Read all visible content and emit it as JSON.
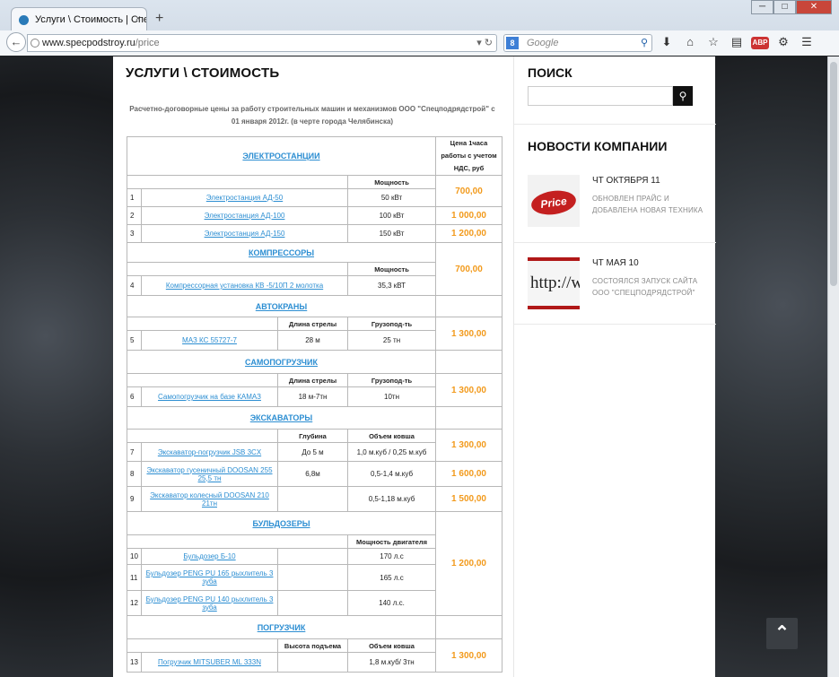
{
  "browser": {
    "tab_title": "Услуги \\ Стоимость | Спе...",
    "tab_close": "×",
    "new_tab": "+",
    "window_buttons": [
      "─",
      "□",
      "✕"
    ],
    "url_host": "www.specpodstroy.ru",
    "url_path": "/price",
    "search_placeholder": "Google",
    "search_engine_letter": "8"
  },
  "page": {
    "title": "УСЛУГИ \\ СТОИМОСТЬ",
    "intro": "Расчетно-договорные цены за работу строительных машин и механизмов ООО \"Спецподрядстрой\" с 01 января 2012г. (в черте города Челябинска)",
    "price_header": "Цена 1часа работы с учетом НДС, руб",
    "sections": {
      "power": "ЭЛЕКТРОСТАНЦИИ",
      "compressors": "КОМПРЕССОРЫ",
      "cranes": "АВТОКРАНЫ",
      "loaders": "САМОПОГРУЗЧИК",
      "excavators": "ЭКСКАВАТОРЫ",
      "bulldozers": "БУЛЬДОЗЕРЫ",
      "forklift": "ПОГРУЗЧИК"
    },
    "col_headers": {
      "power": "Мощность",
      "boom": "Длина стрелы",
      "capacity": "Грузопод-ть",
      "depth": "Глубина",
      "bucket": "Объем ковша",
      "engine": "Мощность двигателя",
      "lift": "Высота подъема"
    },
    "rows": {
      "r1": {
        "num": "1",
        "name": "Электростанция АД-50",
        "spec": "50 кВт"
      },
      "r2": {
        "num": "2",
        "name": "Электростанция АД-100",
        "spec": "100 кВт"
      },
      "r3": {
        "num": "3",
        "name": "Электростанция АД-150",
        "spec": "150 кВт"
      },
      "r4": {
        "num": "4",
        "name": "Компрессорная установка КВ -5/10П 2 молотка",
        "spec": "35,3 кВТ"
      },
      "r5": {
        "num": "5",
        "name": "МАЗ КС 55727-7",
        "a": "28 м",
        "b": "25 тн"
      },
      "r6": {
        "num": "6",
        "name": "Самопогрузчик на базе КАМАЗ",
        "a": "18 м-7тн",
        "b": "10тн"
      },
      "r7": {
        "num": "7",
        "name": "Экскаватор-погрузчик JSB 3CX",
        "a": "До 5 м",
        "b": "1,0 м.куб / 0,25 м.куб"
      },
      "r8": {
        "num": "8",
        "name": "Экскаватор гусеничный DOOSAN 255 25,5 тн",
        "a": "6,8м",
        "b": "0,5-1,4 м.куб"
      },
      "r9": {
        "num": "9",
        "name": "Экскаватор колесный DOOSAN 210 21тн",
        "a": "",
        "b": "0,5-1,18 м.куб"
      },
      "r10": {
        "num": "10",
        "name": "Бульдозер Б-10",
        "spec": "170 л.с"
      },
      "r11": {
        "num": "11",
        "name": "Бульдозер PENG PU 165 рыхлитель 3 зуба",
        "spec": "165 л.с"
      },
      "r12": {
        "num": "12",
        "name": "Бульдозер PENG PU 140 рыхлитель 3 зуба",
        "spec": "140 л.с."
      },
      "r13": {
        "num": "13",
        "name": "Погрузчик MITSUBER ML 333N",
        "a": "",
        "b": "1,8 м.куб/ 3тн"
      }
    },
    "prices": {
      "power_group": "700,00",
      "ad100": "1 000,00",
      "ad150": "1 200,00",
      "compressor": "700,00",
      "crane": "1 300,00",
      "selfloader": "1 300,00",
      "jcb": "1 300,00",
      "doosan255": "1 600,00",
      "doosan210": "1 500,00",
      "bulldozers": "1 200,00",
      "forklift": "1 300,00"
    }
  },
  "sidebar": {
    "search_title": "ПОИСК",
    "search_button_icon": "search-icon",
    "news_title": "НОВОСТИ КОМПАНИИ",
    "news": [
      {
        "date": "ЧТ ОКТЯБРЯ 11",
        "text": "ОБНОВЛЕН ПРАЙС И ДОБАВЛЕНА НОВАЯ ТЕХНИКА",
        "thumb_label": "Price"
      },
      {
        "date": "ЧТ МАЯ 10",
        "text": "СОСТОЯЛСЯ ЗАПУСК САЙТА ООО \"СПЕЦПОДРЯДСТРОЙ\"",
        "thumb_label": "http://w"
      }
    ]
  },
  "to_top_icon": "chevron-up-icon"
}
